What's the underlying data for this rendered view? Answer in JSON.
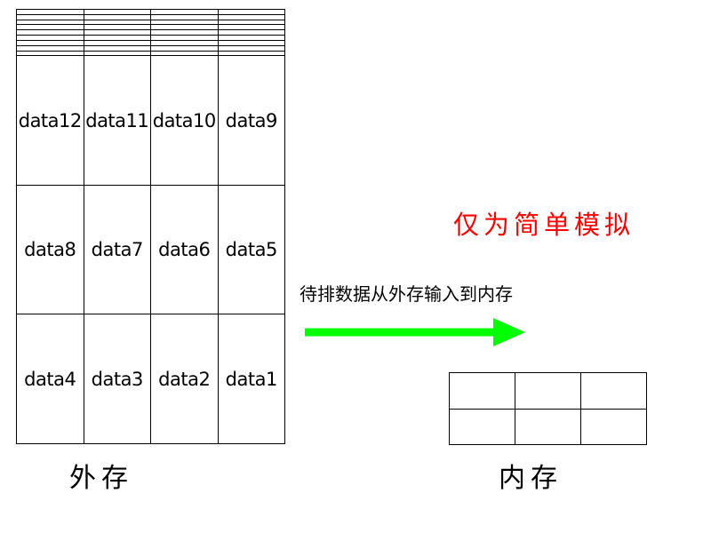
{
  "colors": {
    "arrow": "#00ff00",
    "note_text": "#ff0000",
    "grid_line": "#000000"
  },
  "external_storage": {
    "label": "外存",
    "rows": [
      [
        "",
        "",
        "",
        ""
      ],
      [
        "",
        "",
        "",
        ""
      ],
      [
        "",
        "",
        "",
        ""
      ],
      [
        "",
        "",
        "",
        ""
      ],
      [
        "",
        "",
        "",
        ""
      ],
      [
        "",
        "",
        "",
        ""
      ],
      [
        "",
        "",
        "",
        ""
      ],
      [
        "",
        "",
        "",
        ""
      ],
      [
        "",
        "",
        "",
        ""
      ],
      [
        "data12",
        "data11",
        "data10",
        "data9"
      ],
      [
        "data8",
        "data7",
        "data6",
        "data5"
      ],
      [
        "data4",
        "data3",
        "data2",
        "data1"
      ]
    ]
  },
  "internal_memory": {
    "label": "内存",
    "rows": [
      [
        "",
        "",
        ""
      ],
      [
        "",
        "",
        ""
      ]
    ]
  },
  "note": "仅为简单模拟",
  "arrow_label": "待排数据从外存输入到内存"
}
